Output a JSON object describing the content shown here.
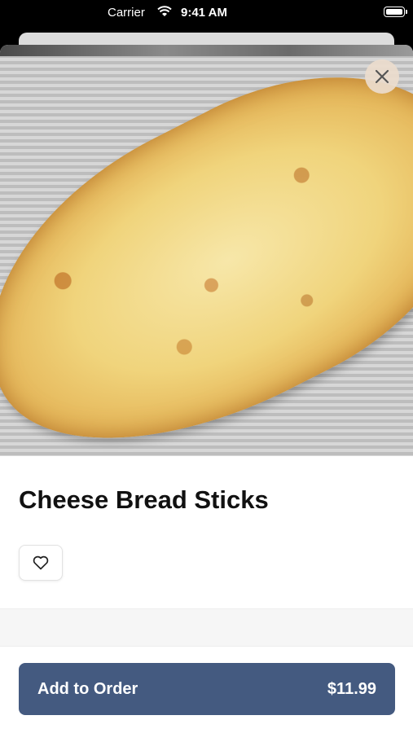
{
  "status_bar": {
    "carrier": "Carrier",
    "time": "9:41 AM"
  },
  "item": {
    "name": "Cheese Bread Sticks"
  },
  "icons": {
    "close": "close-icon",
    "favorite": "heart-icon",
    "wifi": "wifi-icon",
    "battery": "battery-icon"
  },
  "order_button": {
    "label": "Add to Order",
    "price": "$11.99"
  },
  "colors": {
    "accent": "#445a80",
    "sheet": "#ffffff"
  }
}
